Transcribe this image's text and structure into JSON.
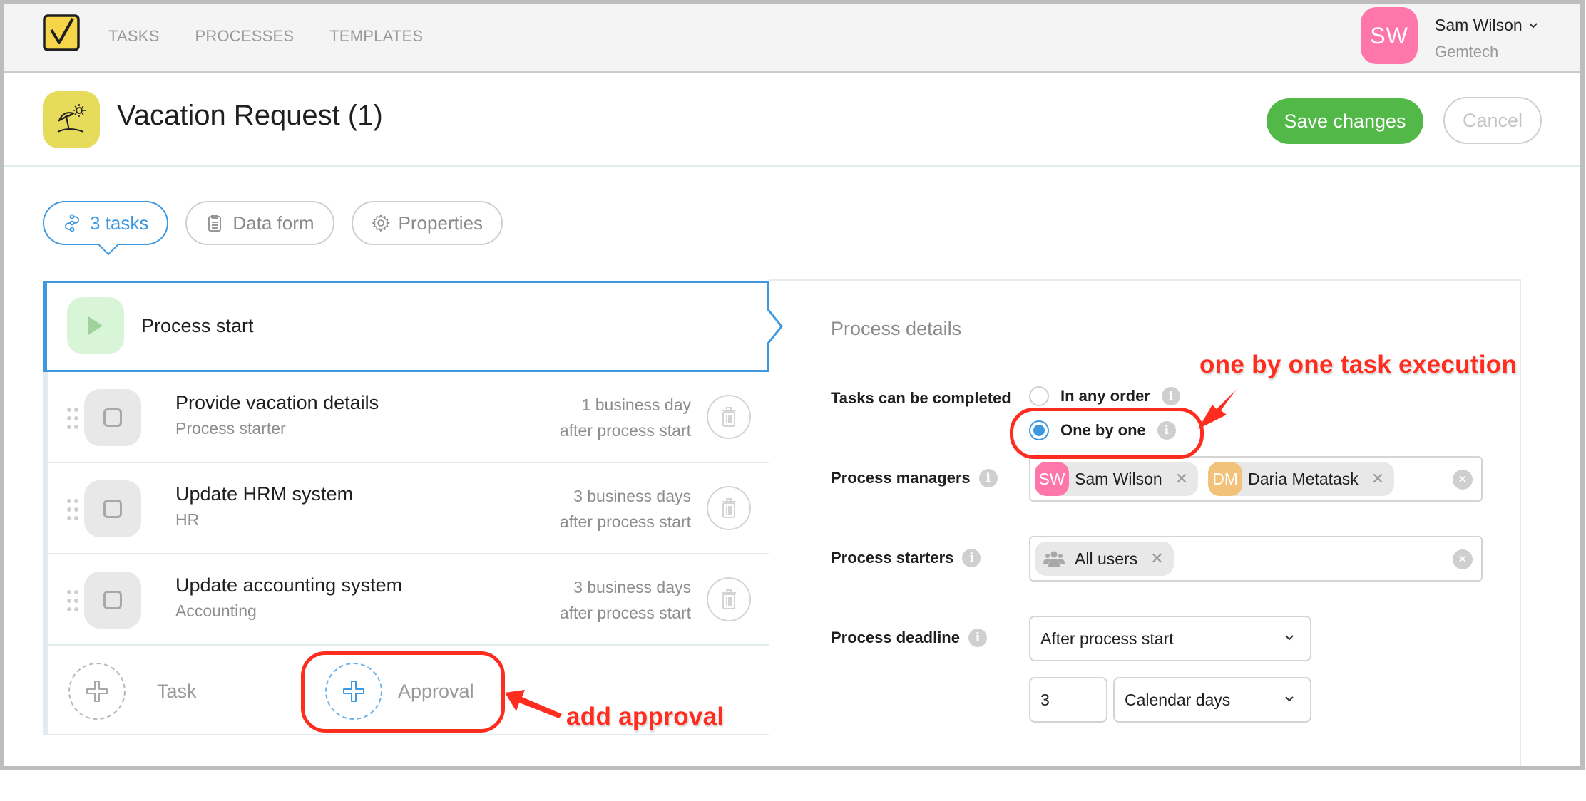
{
  "nav": {
    "items": [
      {
        "label": "TASKS"
      },
      {
        "label": "PROCESSES"
      },
      {
        "label": "TEMPLATES"
      }
    ]
  },
  "user": {
    "initials": "SW",
    "name": "Sam Wilson",
    "organization": "Gemtech",
    "avatar_color": "#ff77aa"
  },
  "header": {
    "title": "Vacation Request (1)",
    "icon": "beach-umbrella-icon",
    "save_label": "Save changes",
    "cancel_label": "Cancel"
  },
  "tabs": [
    {
      "label": "3 tasks",
      "icon": "tasks-flow-icon",
      "active": true
    },
    {
      "label": "Data form",
      "icon": "clipboard-icon",
      "active": false
    },
    {
      "label": "Properties",
      "icon": "gear-icon",
      "active": false
    }
  ],
  "task_list": {
    "start_label": "Process start",
    "tasks": [
      {
        "title": "Provide vacation details",
        "assignee": "Process starter",
        "due_line1": "1 business day",
        "due_line2": "after process start"
      },
      {
        "title": "Update HRM system",
        "assignee": "HR",
        "due_line1": "3 business days",
        "due_line2": "after process start"
      },
      {
        "title": "Update accounting system",
        "assignee": "Accounting",
        "due_line1": "3 business days",
        "due_line2": "after process start"
      }
    ],
    "add_task_label": "Task",
    "add_approval_label": "Approval"
  },
  "details": {
    "title": "Process details",
    "completion_label": "Tasks can be completed",
    "completion_options": [
      {
        "label": "In any order",
        "checked": false
      },
      {
        "label": "One by one",
        "checked": true
      }
    ],
    "managers_label": "Process managers",
    "managers": [
      {
        "initials": "SW",
        "name": "Sam Wilson",
        "color": "#ff77aa"
      },
      {
        "initials": "DM",
        "name": "Daria Metatask",
        "color": "#f2c27b"
      }
    ],
    "starters_label": "Process starters",
    "starters": [
      {
        "name": "All users",
        "icon": "users-group-icon"
      }
    ],
    "deadline_label": "Process deadline",
    "deadline_type": "After process start",
    "deadline_amount": "3",
    "deadline_unit": "Calendar days"
  },
  "annotations": {
    "one_by_one": "one by one task execution",
    "add_approval": "add approval",
    "color": "#ff2d1f"
  },
  "colors": {
    "accent_blue": "#3d98e0",
    "save_green": "#52b848",
    "logo_yellow": "#f6d54a",
    "process_icon_yellow": "#e6db5a"
  }
}
